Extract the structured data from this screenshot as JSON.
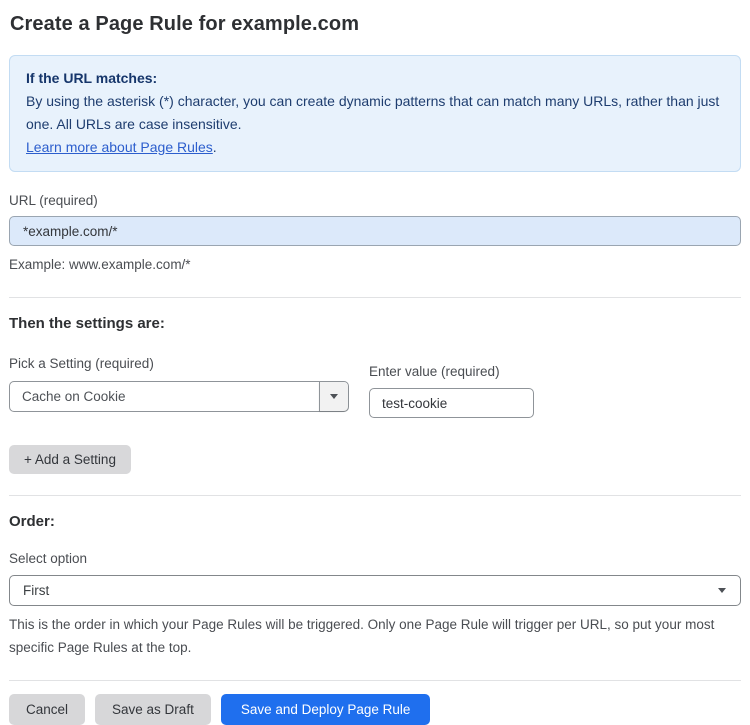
{
  "page": {
    "title": "Create a Page Rule for example.com"
  },
  "info_box": {
    "heading": "If the URL matches:",
    "body": "By using the asterisk (*) character, you can create dynamic patterns that can match many URLs, rather than just one. All URLs are case insensitive.",
    "link_label": "Learn more about Page Rules",
    "link_suffix": "."
  },
  "url_field": {
    "label": "URL (required)",
    "value": "*example.com/*",
    "helper": "Example: www.example.com/*"
  },
  "settings_section": {
    "heading": "Then the settings are:",
    "setting_label": "Pick a Setting (required)",
    "setting_selected_value": "Cache on Cookie",
    "value_label": "Enter value (required)",
    "value_input_value": "test-cookie",
    "add_button_label": "+ Add a Setting"
  },
  "order_section": {
    "heading": "Order:",
    "select_label": "Select option",
    "selected_option": "First",
    "helper": "This is the order in which your Page Rules will be triggered. Only one Page Rule will trigger per URL, so put your most specific Page Rules at the top."
  },
  "footer": {
    "cancel_label": "Cancel",
    "save_draft_label": "Save as Draft",
    "save_deploy_label": "Save and Deploy Page Rule"
  },
  "icons": {
    "setting_dropdown_arrow": "chevron-down",
    "order_select_arrow": "chevron-down"
  },
  "colors": {
    "accent_blue": "#1f6fee",
    "info_box_background": "#e8f2fc",
    "info_box_border": "#c3dcf3",
    "info_box_text": "#1e3d6f",
    "link_blue": "#2c5ecd",
    "url_input_background": "#dce9fa",
    "gray_button_background": "#d7d7d9"
  }
}
